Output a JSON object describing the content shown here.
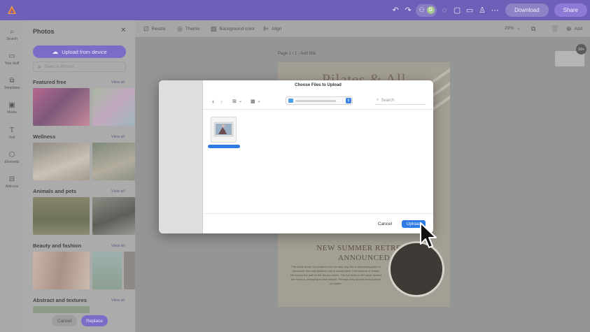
{
  "topbar": {
    "download_label": "Download",
    "share_label": "Share",
    "avatar_letter": "G",
    "brand_color": "#6f5fb8"
  },
  "rail": {
    "items": [
      {
        "label": "Search",
        "icon": "search-icon"
      },
      {
        "label": "Your stuff",
        "icon": "folder-icon"
      },
      {
        "label": "Templates",
        "icon": "templates-icon"
      },
      {
        "label": "Media",
        "icon": "media-icon"
      },
      {
        "label": "Text",
        "icon": "text-icon"
      },
      {
        "label": "Elements",
        "icon": "elements-icon"
      },
      {
        "label": "Add-ons",
        "icon": "addons-icon"
      }
    ]
  },
  "panel": {
    "title": "Photos",
    "upload_label": "Upload from device",
    "search_placeholder": "Search Photos",
    "view_all": "View all",
    "sections": [
      {
        "title": "Featured free"
      },
      {
        "title": "Wellness"
      },
      {
        "title": "Animals and pets"
      },
      {
        "title": "Beauty and fashion"
      },
      {
        "title": "Abstract and textures"
      }
    ],
    "cancel_label": "Cancel",
    "replace_label": "Replace"
  },
  "toolbar": {
    "resize": "Resize",
    "theme": "Theme",
    "background": "Background color",
    "align": "Align",
    "zoom": "20%",
    "add": "Add"
  },
  "canvas": {
    "page_label": "Page 1 / 1 - Add title",
    "badge": "10+",
    "headline_top": "Pilates & All",
    "headline_line1": "NEW SUMMER RETREAT",
    "headline_line2": "ANNOUNCED",
    "body_text": "The quick brown fox jumped over the lazy dog into a shimmering pool of lemonade that had gathered into a nearby field. Soft clusters of leaves fell across the path to the dense woods. The fox looks to the west, toward the horizon, preparing to dive deeper. Perhaps they should have jumped on earlier."
  },
  "dialog": {
    "title": "Choose Files to Upload",
    "search_placeholder": "Search",
    "cancel_label": "Cancel",
    "upload_label": "Upload",
    "accent": "#2f7be6"
  }
}
